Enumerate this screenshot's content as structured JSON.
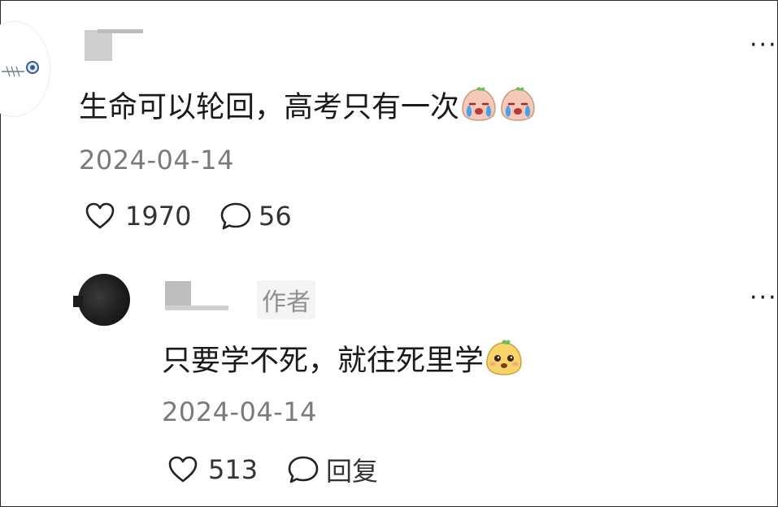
{
  "comments": [
    {
      "text": "生命可以轮回，高考只有一次",
      "date": "2024-04-14",
      "likes": "1970",
      "replies": "56",
      "emoji": [
        "crying-face-icon",
        "crying-face-icon"
      ]
    },
    {
      "author_badge": "作者",
      "text": "只要学不死，就往死里学",
      "date": "2024-04-14",
      "likes": "513",
      "reply_label": "回复",
      "emoji": [
        "smug-face-icon"
      ]
    }
  ],
  "more_glyph": "⋮"
}
